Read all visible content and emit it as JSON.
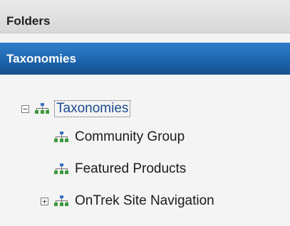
{
  "headers": {
    "folders": "Folders",
    "taxonomies": "Taxonomies"
  },
  "tree": {
    "root": {
      "label": "Taxonomies",
      "expanded": true,
      "toggle": "−",
      "icon": "sitemap-icon"
    },
    "children": [
      {
        "label": "Community Group",
        "icon": "sitemap-icon"
      },
      {
        "label": "Featured Products",
        "icon": "sitemap-icon"
      },
      {
        "label": "OnTrek Site Navigation",
        "expanded": false,
        "toggle": "+",
        "icon": "sitemap-icon"
      }
    ]
  },
  "colors": {
    "accent_header": "#1f66ad",
    "icon_blue": "#3a6fc4",
    "icon_green": "#3c9a3c"
  }
}
